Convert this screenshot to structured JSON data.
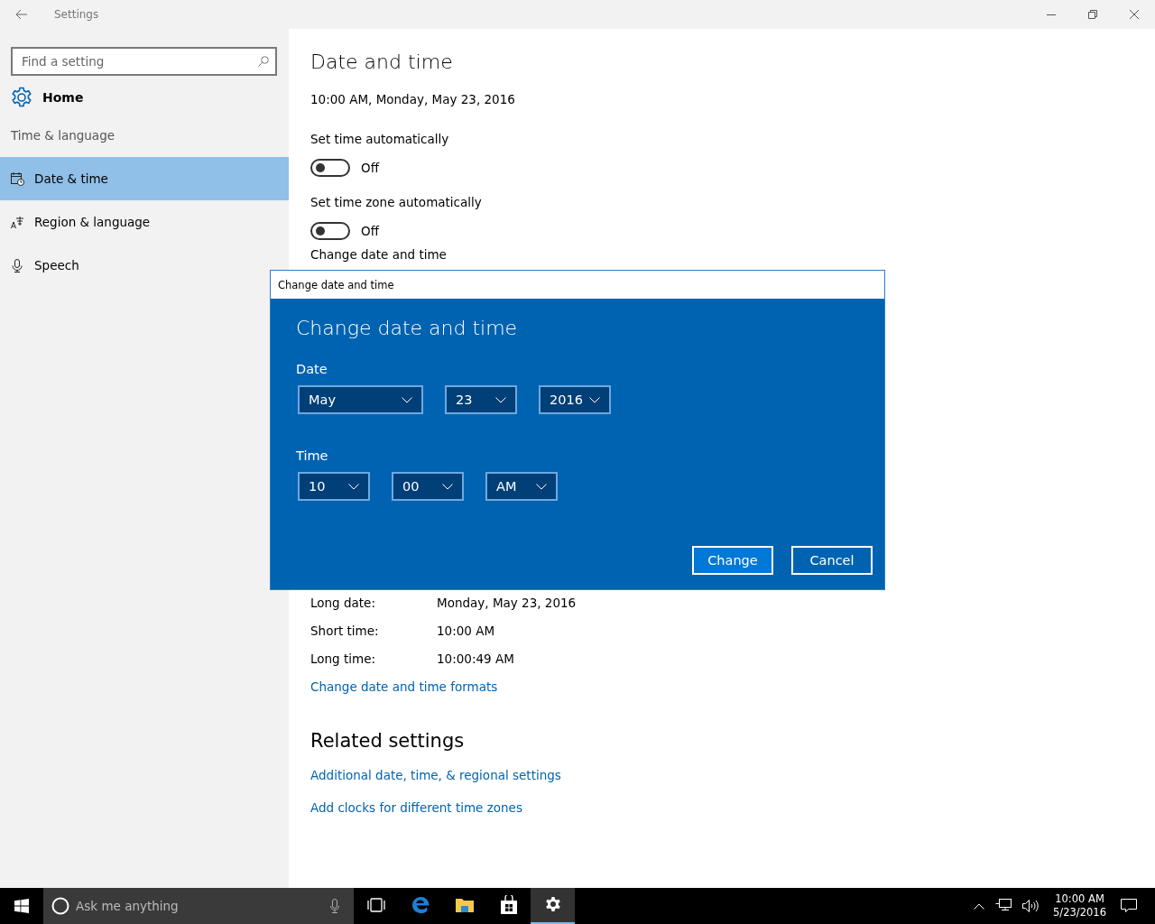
{
  "window": {
    "title": "Settings"
  },
  "sidebar": {
    "search": {
      "placeholder": "Find a setting"
    },
    "home": "Home",
    "section": "Time & language",
    "items": [
      {
        "label": "Date & time",
        "kind": "calendar",
        "selected": true
      },
      {
        "label": "Region & language",
        "kind": "language",
        "selected": false
      },
      {
        "label": "Speech",
        "kind": "microphone",
        "selected": false
      }
    ]
  },
  "page": {
    "title": "Date and time",
    "current": "10:00 AM, Monday, May 23, 2016",
    "toggles": [
      {
        "label": "Set time automatically",
        "on": false,
        "state": "Off"
      },
      {
        "label": "Set time zone automatically",
        "on": false,
        "state": "Off"
      }
    ],
    "change_heading": "Change date and time",
    "formats": [
      {
        "label": "Long date:",
        "value": "Monday, May 23, 2016"
      },
      {
        "label": "Short time:",
        "value": "10:00 AM"
      },
      {
        "label": "Long time:",
        "value": "10:00:49 AM"
      }
    ],
    "formats_link": "Change date and time formats",
    "related_title": "Related settings",
    "related_links": [
      "Additional date, time, & regional settings",
      "Add clocks for different time zones"
    ]
  },
  "dialog": {
    "title": "Change date and time",
    "heading": "Change date and time",
    "groups": [
      {
        "label": "Date",
        "fields": [
          {
            "value": "May",
            "kind": "wide"
          },
          {
            "value": "23",
            "kind": "narrow"
          },
          {
            "value": "2016",
            "kind": "narrow"
          }
        ]
      },
      {
        "label": "Time",
        "fields": [
          {
            "value": "10",
            "kind": "narrow"
          },
          {
            "value": "00",
            "kind": "narrow"
          },
          {
            "value": "AM",
            "kind": "narrow"
          }
        ]
      }
    ],
    "buttons": [
      {
        "label": "Change",
        "kind": "primary"
      },
      {
        "label": "Cancel",
        "kind": "secondary"
      }
    ]
  },
  "taskbar": {
    "search": {
      "placeholder": "Ask me anything"
    },
    "apps": [
      {
        "kind": "task-view",
        "selected": false
      },
      {
        "kind": "browser",
        "selected": false
      },
      {
        "kind": "folder",
        "selected": false
      },
      {
        "kind": "store",
        "selected": false
      },
      {
        "kind": "settings",
        "selected": true
      }
    ],
    "clock": {
      "time": "10:00 AM",
      "date": "5/23/2016"
    }
  }
}
